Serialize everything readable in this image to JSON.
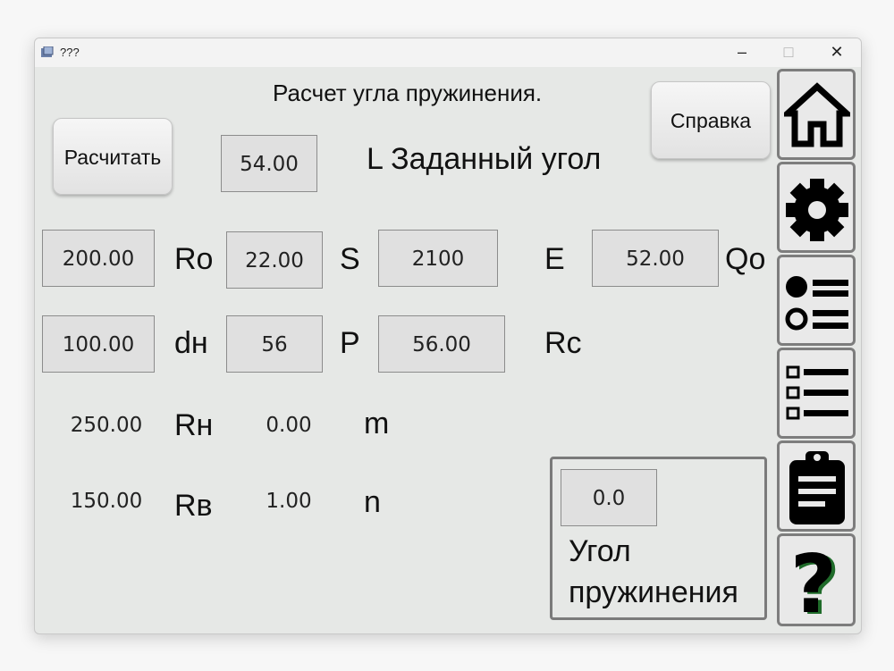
{
  "window": {
    "title": "???",
    "minimize": "–",
    "maximize": "□",
    "close": "✕"
  },
  "header": {
    "title": "Расчет угла пружинения.",
    "calc_button": "Расчитать",
    "help_button": "Справка",
    "angle_value": "54.00",
    "angle_label": "L Заданный угол"
  },
  "row1": {
    "v1": "200.00",
    "l1": "Ro",
    "v2": "22.00",
    "l2": "S",
    "v3": "2100",
    "l3": "E",
    "v4": "52.00",
    "l4": "Qo"
  },
  "row2": {
    "v1": "100.00",
    "l1": "dн",
    "v2": "56",
    "l2": "P",
    "v3": "56.00",
    "l3": "Rc"
  },
  "row3": {
    "v1": "250.00",
    "l1": "Rн",
    "v2": "0.00",
    "l2": "m"
  },
  "row4": {
    "v1": "150.00",
    "l1": "Rв",
    "v2": "1.00",
    "l2": "n"
  },
  "result": {
    "value": "0.0",
    "label_line1": "Угол",
    "label_line2": "пружинения"
  },
  "sidebar": [
    {
      "icon": "home-icon"
    },
    {
      "icon": "gear-icon"
    },
    {
      "icon": "options-list-icon"
    },
    {
      "icon": "checklist-icon"
    },
    {
      "icon": "clipboard-icon"
    },
    {
      "icon": "question-icon",
      "text": "?"
    }
  ],
  "colors": {
    "background": "#e6e8e6",
    "field": "#e0e0e0",
    "border": "#7a7a7a",
    "question_accent": "#1f6b2a"
  }
}
